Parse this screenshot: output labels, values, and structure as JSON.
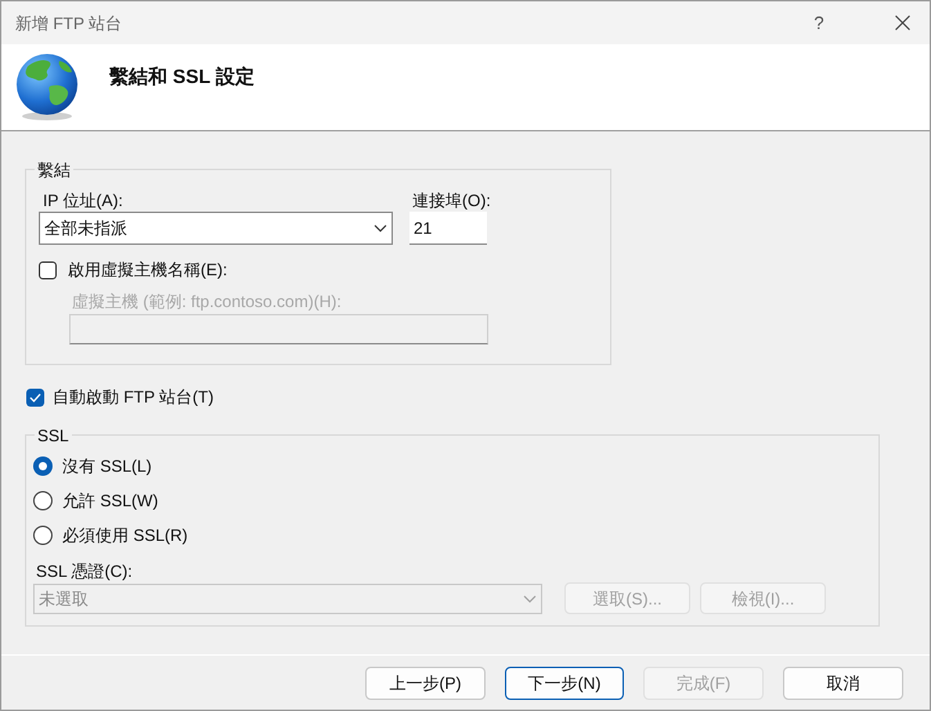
{
  "window": {
    "title": "新增 FTP 站台",
    "help": "?"
  },
  "header": {
    "title": "繫結和 SSL 設定"
  },
  "binding": {
    "legend": "繫結",
    "ip_label": "IP 位址(A):",
    "ip_value": "全部未指派",
    "port_label": "連接埠(O):",
    "port_value": "21",
    "virtual_host": {
      "label": "啟用虛擬主機名稱(E):",
      "checked": false
    },
    "host": {
      "label": "虛擬主機 (範例: ftp.contoso.com)(H):",
      "disabled": true
    }
  },
  "auto_start": {
    "label": "自動啟動 FTP 站台(T)",
    "checked": true
  },
  "ssl": {
    "legend": "SSL",
    "options": [
      {
        "label": "沒有 SSL(L)",
        "selected": true
      },
      {
        "label": "允許 SSL(W)",
        "selected": false
      },
      {
        "label": "必須使用 SSL(R)",
        "selected": false
      }
    ],
    "cert_label": "SSL 憑證(C):",
    "cert_value": "未選取",
    "cert_disabled": true,
    "buttons": [
      {
        "label": "選取(S)...",
        "disabled": true
      },
      {
        "label": "檢視(I)...",
        "disabled": true
      }
    ]
  },
  "footer": {
    "buttons": [
      {
        "label": "上一步(P)",
        "disabled": false,
        "default": false
      },
      {
        "label": "下一步(N)",
        "disabled": false,
        "default": true
      },
      {
        "label": "完成(F)",
        "disabled": true,
        "default": false
      },
      {
        "label": "取消",
        "disabled": false,
        "default": false
      }
    ]
  }
}
